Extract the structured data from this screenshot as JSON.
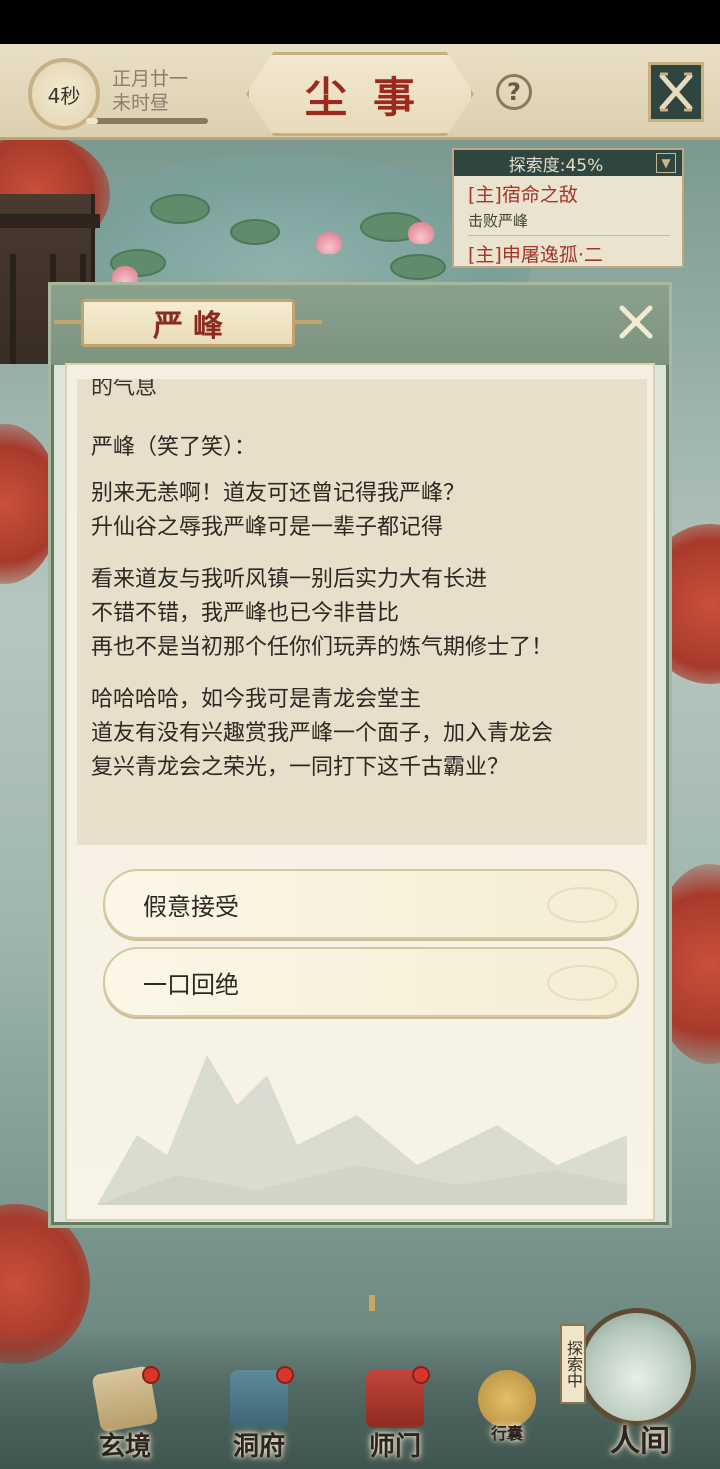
{
  "header": {
    "timer": "4秒",
    "date_line1": "正月廿一",
    "date_line2": "未时昼",
    "time_progress": 0.1,
    "title": "尘事",
    "help_label": "?"
  },
  "exploration": {
    "label": "探索度:45%",
    "progress_percent": 45,
    "quests": [
      {
        "title": "[主]宿命之敌",
        "desc": "击败严峰"
      },
      {
        "title": "[主]申屠逸孤·二",
        "desc": ""
      }
    ]
  },
  "dialog": {
    "speaker_name": "严峰",
    "clipped_line": "的气息",
    "speaker_line": "严峰（笑了笑）：",
    "paragraphs": [
      [
        "别来无恙啊！道友可还曾记得我严峰？",
        "升仙谷之辱我严峰可是一辈子都记得"
      ],
      [
        "看来道友与我听风镇一别后实力大有长进",
        "不错不错，我严峰也已今非昔比",
        "再也不是当初那个任你们玩弄的炼气期修士了！"
      ],
      [
        "哈哈哈哈，如今我可是青龙会堂主",
        "道友有没有兴趣赏我严峰一个面子，加入青龙会",
        "复兴青龙会之荣光，一同打下这千古霸业？"
      ]
    ],
    "choices": [
      "假意接受",
      "一口回绝"
    ]
  },
  "bottom_nav": {
    "items": [
      "玄境",
      "洞府",
      "师门",
      "行囊"
    ],
    "world_status": "探索中",
    "world_label": "人间"
  },
  "colors": {
    "title_red": "#9b2a1e",
    "quest_red": "#a6342a",
    "dialog_green": "#7c937f",
    "parchment": "#f4efe0"
  }
}
